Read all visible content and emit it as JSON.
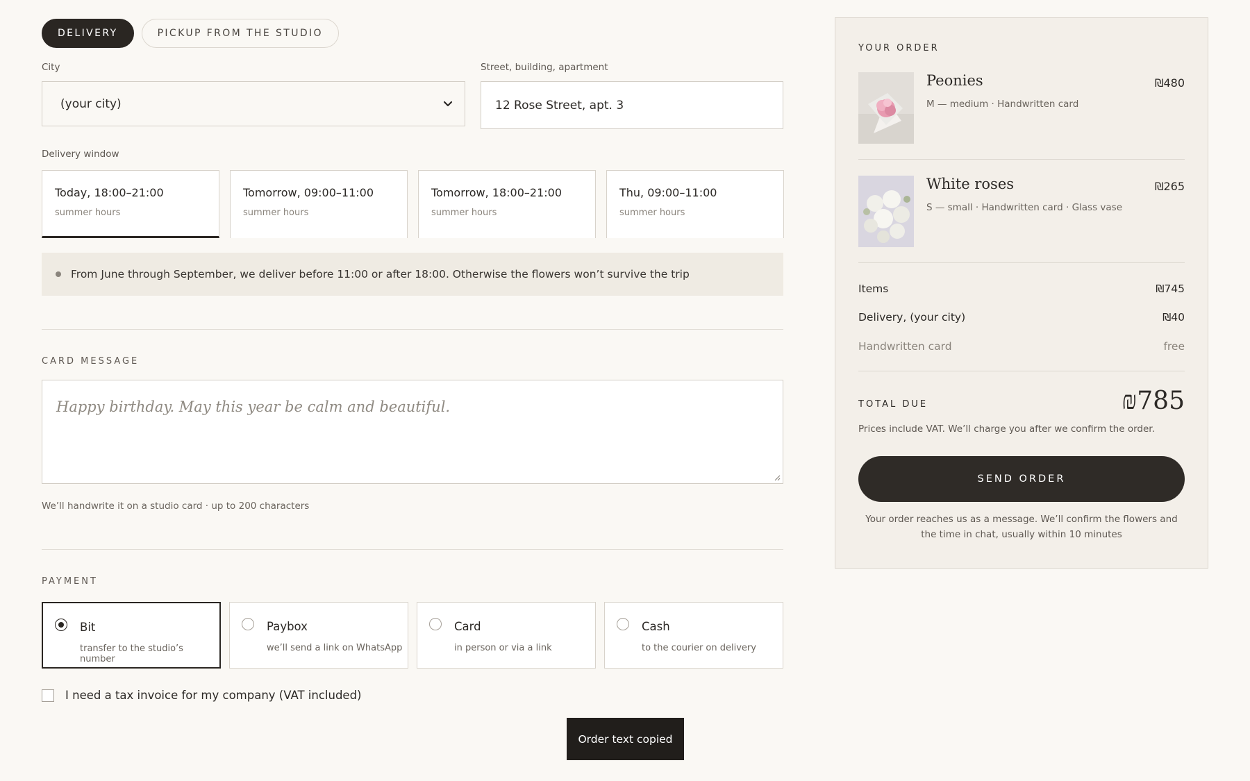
{
  "delivery_mode": {
    "options": [
      "Delivery",
      "Pickup from the studio"
    ],
    "selected": "Delivery"
  },
  "address": {
    "city_label": "City",
    "city_value": "(your city)",
    "street_label": "Street, building, apartment",
    "street_value": "12 Rose Street, apt. 3"
  },
  "delivery_window": {
    "label": "Delivery window",
    "slots": [
      {
        "time": "Today, 18:00–21:00",
        "note": "summer hours",
        "selected": true
      },
      {
        "time": "Tomorrow, 09:00–11:00",
        "note": "summer hours",
        "selected": false
      },
      {
        "time": "Tomorrow, 18:00–21:00",
        "note": "summer hours",
        "selected": false
      },
      {
        "time": "Thu, 09:00–11:00",
        "note": "summer hours",
        "selected": false
      }
    ],
    "notice": "From June through September, we deliver before 11:00 or after 18:00. Otherwise the flowers won’t survive the trip"
  },
  "card_message": {
    "title": "Card message",
    "placeholder": "Happy birthday. May this year be calm and beautiful.",
    "helper": "We’ll handwrite it on a studio card · up to 200 characters"
  },
  "payment": {
    "title": "Payment",
    "options": [
      {
        "name": "Bit",
        "note": "transfer to the studio’s number",
        "selected": true
      },
      {
        "name": "Paybox",
        "note": "we’ll send a link on WhatsApp",
        "selected": false
      },
      {
        "name": "Card",
        "note": "in person or via a link",
        "selected": false
      },
      {
        "name": "Cash",
        "note": "to the courier on delivery",
        "selected": false
      }
    ],
    "invoice_label": "I need a tax invoice for my company (VAT included)"
  },
  "toast": "Order text copied",
  "order": {
    "title": "Your order",
    "items": [
      {
        "name": "Peonies",
        "price": "₪480",
        "options": "M — medium · Handwritten card"
      },
      {
        "name": "White roses",
        "price": "₪265",
        "options": "S — small · Handwritten card · Glass vase"
      }
    ],
    "lines": [
      {
        "label": "Items",
        "value": "₪745"
      },
      {
        "label": "Delivery, (your city)",
        "value": "₪40"
      },
      {
        "label": "Handwritten card",
        "value": "free"
      }
    ],
    "total_label": "Total due",
    "total_value": "₪785",
    "vat_note": "Prices include VAT. We’ll charge you after we confirm the order.",
    "send_label": "Send order",
    "send_note": "Your order reaches us as a message. We’ll confirm the flowers and the time in chat, usually within 10 minutes"
  },
  "colors": {
    "background": "#faf8f4",
    "primary_dark": "#2a2622",
    "summary_panel": "#f3efe9",
    "notice_bg": "#efebe3"
  }
}
